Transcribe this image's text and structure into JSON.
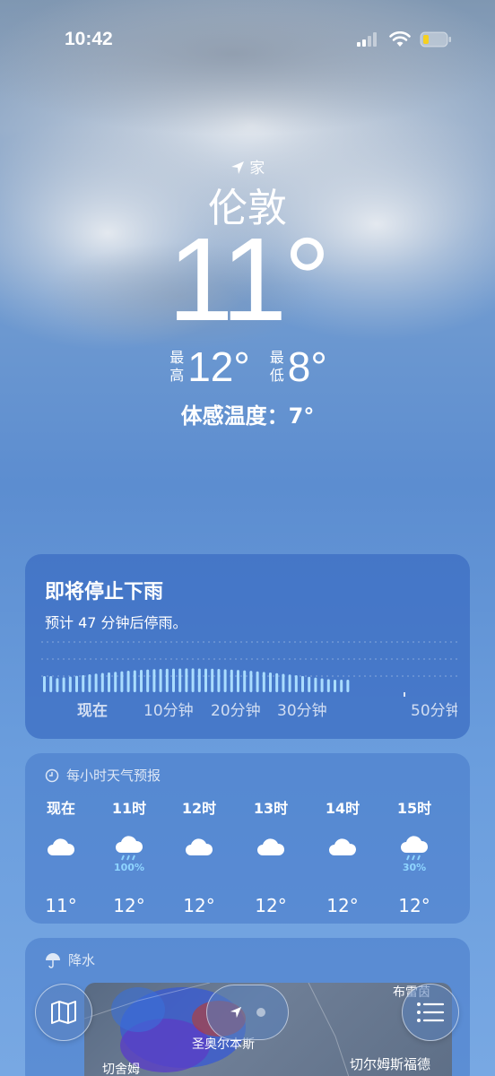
{
  "status_bar": {
    "time": "10:42",
    "icons": [
      "cellular-signal-icon",
      "wifi-icon",
      "battery-low-icon"
    ],
    "battery_color": "#f5d020"
  },
  "location": {
    "label": "家",
    "icon": "location-arrow-icon",
    "city": "伦敦"
  },
  "current": {
    "temperature": "11°",
    "high_label": "最高",
    "high": "12°",
    "low_label": "最低",
    "low": "8°",
    "feels_like": "体感温度：7°"
  },
  "rain_card": {
    "title": "即将停止下雨",
    "subtitle": "预计 47 分钟后停雨。",
    "axis_labels": [
      "现在",
      "10分钟",
      "20分钟",
      "30分钟",
      "50分钟"
    ],
    "bar_color": "#a9dcff"
  },
  "hourly_card": {
    "title": "每小时天气预报",
    "icon": "clock-icon",
    "hours": [
      {
        "time": "现在",
        "icon": "cloud-icon",
        "precip": "",
        "temp": "11°"
      },
      {
        "time": "11时",
        "icon": "cloud-rain-icon",
        "precip": "100%",
        "temp": "12°"
      },
      {
        "time": "12时",
        "icon": "cloud-icon",
        "precip": "",
        "temp": "12°"
      },
      {
        "time": "13时",
        "icon": "cloud-icon",
        "precip": "",
        "temp": "12°"
      },
      {
        "time": "14时",
        "icon": "cloud-icon",
        "precip": "",
        "temp": "12°"
      },
      {
        "time": "15时",
        "icon": "cloud-rain-icon",
        "precip": "30%",
        "temp": "12°"
      }
    ]
  },
  "precip_card": {
    "title": "降水",
    "icon": "umbrella-icon",
    "map_labels": [
      "布雷茵",
      "圣奥尔本斯",
      "切舍姆",
      "切尔姆斯福德"
    ]
  },
  "bottom_bar": {
    "map_button": "map-icon",
    "list_button": "list-icon",
    "location_page": "location-arrow-icon"
  }
}
